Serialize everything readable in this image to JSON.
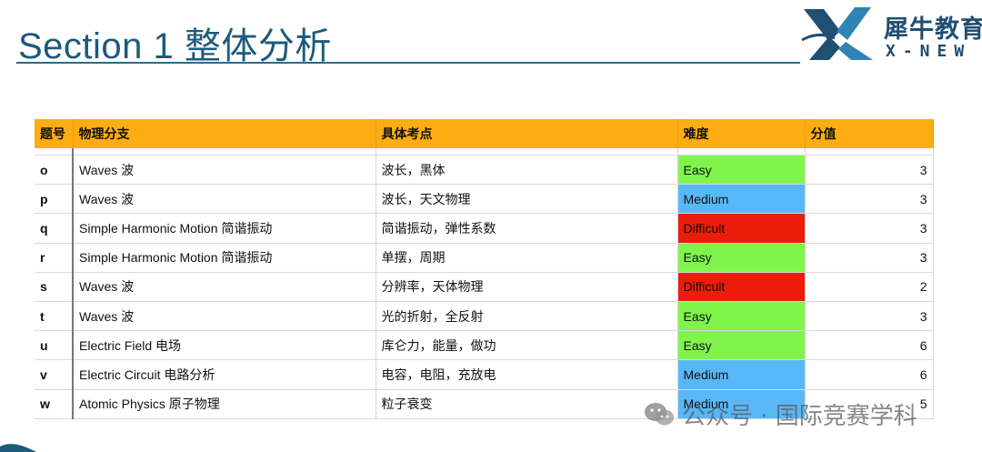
{
  "header": {
    "title": "Section 1 整体分析"
  },
  "logo": {
    "cn_text": "犀牛教育",
    "en_text": "X-NEW",
    "color": "#1f4f73"
  },
  "table": {
    "headers": [
      "题号",
      "物理分支",
      "具体考点",
      "难度",
      "分值"
    ],
    "header_color": "#fbad11",
    "difficulty_colors": {
      "Easy": "#7ff54c",
      "Medium": "#58b8f7",
      "Difficult": "#ec1c0a"
    },
    "rows": [
      {
        "no": "o",
        "branch": "Waves 波",
        "topic": "波长，黑体",
        "difficulty": "Easy",
        "score": "3"
      },
      {
        "no": "p",
        "branch": "Waves 波",
        "topic": "波长，天文物理",
        "difficulty": "Medium",
        "score": "3"
      },
      {
        "no": "q",
        "branch": "Simple Harmonic Motion 简谐振动",
        "topic": "简谐振动，弹性系数",
        "difficulty": "Difficult",
        "score": "3"
      },
      {
        "no": "r",
        "branch": "Simple Harmonic Motion 简谐振动",
        "topic": "单摆，周期",
        "difficulty": "Easy",
        "score": "3"
      },
      {
        "no": "s",
        "branch": "Waves 波",
        "topic": "分辨率，天体物理",
        "difficulty": "Difficult",
        "score": "2"
      },
      {
        "no": "t",
        "branch": "Waves 波",
        "topic": "光的折射，全反射",
        "difficulty": "Easy",
        "score": "3"
      },
      {
        "no": "u",
        "branch": "Electric Field 电场",
        "topic": "库仑力，能量，做功",
        "difficulty": "Easy",
        "score": "6"
      },
      {
        "no": "v",
        "branch": "Electric Circuit 电路分析",
        "topic": "电容，电阻，充放电",
        "difficulty": "Medium",
        "score": "6"
      },
      {
        "no": "w",
        "branch": "Atomic Physics 原子物理",
        "topic": "粒子衰变",
        "difficulty": "Medium",
        "score": "5"
      }
    ]
  },
  "watermark": {
    "text": "公众号 · 国际竞赛学科",
    "icon": "wechat-icon"
  }
}
